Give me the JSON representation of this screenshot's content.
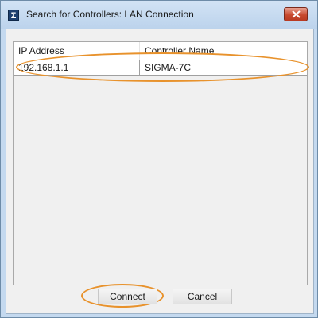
{
  "window": {
    "title": "Search for Controllers: LAN Connection",
    "app_icon_glyph": "Σ",
    "close_icon": "close-icon"
  },
  "table": {
    "columns": [
      "IP Address",
      "Controller Name"
    ],
    "rows": [
      {
        "ip": "192.168.1.1",
        "name": "SIGMA-7C"
      }
    ]
  },
  "buttons": {
    "connect": "Connect",
    "cancel": "Cancel"
  },
  "colors": {
    "highlight_ring": "#e8922c",
    "close_button": "#c84a2e"
  }
}
